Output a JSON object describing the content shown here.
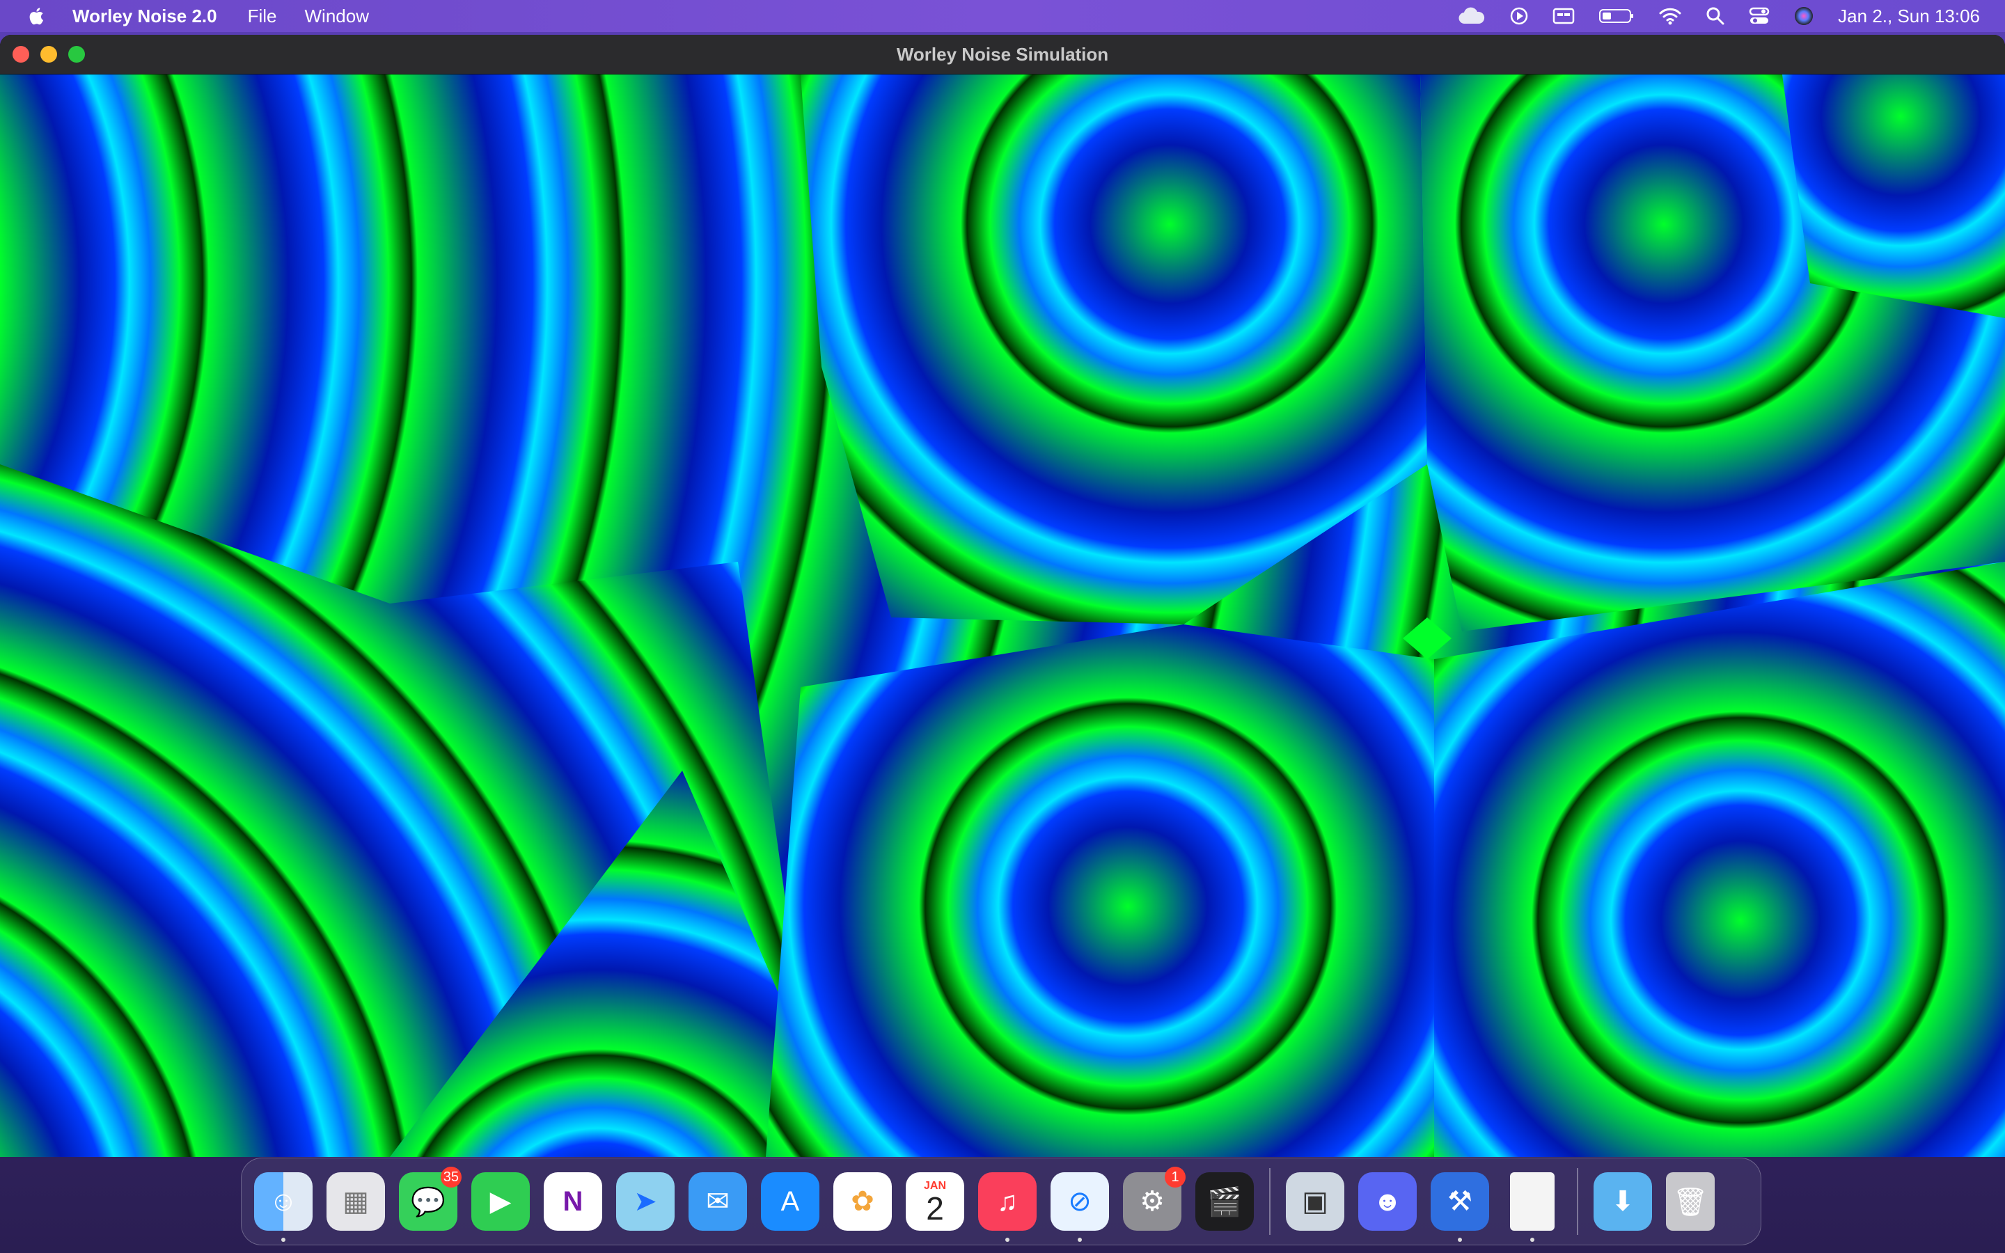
{
  "menubar": {
    "app_name": "Worley Noise 2.0",
    "menus": [
      "File",
      "Window"
    ],
    "status_icons": [
      "icloud-icon",
      "play-icon",
      "display-icon",
      "battery-icon",
      "wifi-icon",
      "search-icon",
      "control-center-icon",
      "siri-icon"
    ],
    "clock": "Jan 2., Sun  13:06"
  },
  "window": {
    "title": "Worley Noise Simulation",
    "canvas": {
      "description_colors": [
        "#00ff2a",
        "#0033ff",
        "#00e5ff",
        "#003300"
      ]
    }
  },
  "dock": {
    "items": [
      {
        "name": "finder-icon",
        "glyph": "☺",
        "running": true
      },
      {
        "name": "launchpad-icon",
        "glyph": "▦",
        "running": false
      },
      {
        "name": "messages-icon",
        "glyph": "💬",
        "badge": "35",
        "running": false
      },
      {
        "name": "facetime-icon",
        "glyph": "▶",
        "running": false
      },
      {
        "name": "onenote-icon",
        "glyph": "N",
        "running": false
      },
      {
        "name": "maps-icon",
        "glyph": "➤",
        "running": false
      },
      {
        "name": "mail-icon",
        "glyph": "✉",
        "running": false
      },
      {
        "name": "app-store-icon",
        "glyph": "A",
        "running": false
      },
      {
        "name": "photos-icon",
        "glyph": "✿",
        "running": false
      },
      {
        "name": "calendar-icon",
        "month": "JAN",
        "day": "2",
        "running": false
      },
      {
        "name": "music-icon",
        "glyph": "♫",
        "running": true
      },
      {
        "name": "safari-icon",
        "glyph": "⊘",
        "running": true
      },
      {
        "name": "system-settings-icon",
        "glyph": "⚙",
        "badge": "1",
        "running": false
      },
      {
        "name": "final-cut-pro-icon",
        "glyph": "🎬",
        "running": false
      }
    ],
    "items2": [
      {
        "name": "preview-icon",
        "glyph": "▣",
        "running": false
      },
      {
        "name": "discord-icon",
        "glyph": "☻",
        "running": false
      },
      {
        "name": "xcode-icon",
        "glyph": "⚒",
        "running": true
      },
      {
        "name": "document-icon",
        "glyph": "",
        "running": true
      }
    ],
    "items3": [
      {
        "name": "downloads-folder-icon",
        "glyph": "⬇",
        "running": false
      },
      {
        "name": "trash-icon",
        "glyph": "🗑",
        "running": false
      }
    ]
  }
}
